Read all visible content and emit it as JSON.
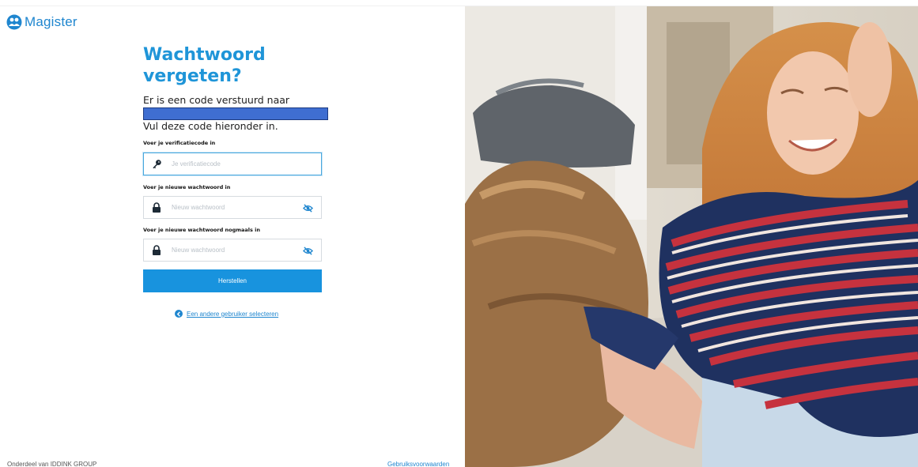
{
  "brand": {
    "name": "Magister",
    "color": "#1f86cf",
    "logo_icon": "magister-people-icon"
  },
  "form": {
    "title_line1": "Wachtwoord",
    "title_line2": "vergeten?",
    "sent_text": "Er is een code verstuurd naar",
    "instruction": "Vul deze code hieronder in.",
    "code_label": "Voer je verificatiecode in",
    "code_placeholder": "Je verificatiecode",
    "code_icon": "key-icon",
    "new_pw_label": "Voer je nieuwe wachtwoord in",
    "new_pw_placeholder": "Nieuw wachtwoord",
    "repeat_pw_label": "Voer je nieuwe wachtwoord nogmaals in",
    "repeat_pw_placeholder": "Nieuw wachtwoord",
    "lock_icon": "lock-icon",
    "eye_icon": "eye-slash-icon",
    "submit_label": "Herstellen",
    "submit_color": "#1893de",
    "other_user_label": "Een andere gebruiker selecteren",
    "other_user_icon": "arrow-left-circle-icon"
  },
  "footer": {
    "left_text": "Onderdeel van IDDINK GROUP",
    "right_link": "Gebruiksvoorwaarden"
  }
}
